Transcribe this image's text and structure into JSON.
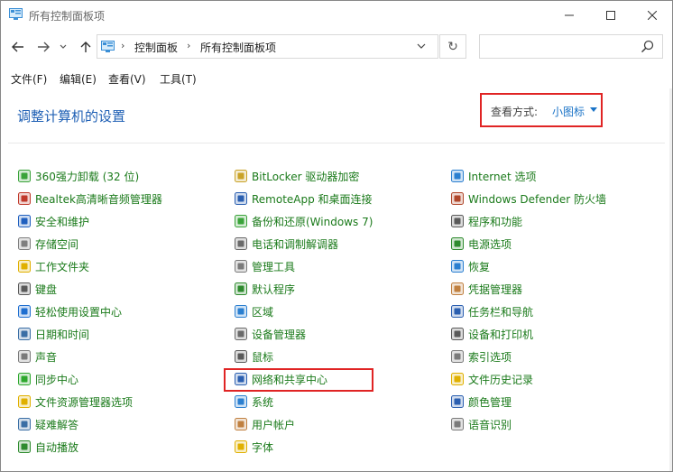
{
  "window": {
    "title": "所有控制面板项",
    "controls": {
      "minimize": "—",
      "maximize": "☐",
      "close": "✕"
    }
  },
  "nav": {
    "back": "←",
    "forward": "→",
    "history": "⌄",
    "up": "↑",
    "breadcrumb": [
      "控制面板",
      "所有控制面板项"
    ],
    "separator": "›",
    "dropdown": "⌄",
    "refresh": "↻",
    "search_placeholder": ""
  },
  "menu": [
    "文件(F)",
    "编辑(E)",
    "查看(V)",
    "工具(T)"
  ],
  "main": {
    "heading": "调整计算机的设置",
    "view_by_label": "查看方式:",
    "view_by_value": "小图标"
  },
  "items": [
    {
      "label": "360强力卸载 (32 位)",
      "icon": "uninstall-icon",
      "color": "#3aa33a"
    },
    {
      "label": "Realtek高清晰音频管理器",
      "icon": "audio-manager-icon",
      "color": "#c0392b"
    },
    {
      "label": "安全和维护",
      "icon": "flag-icon",
      "color": "#1f5fbf"
    },
    {
      "label": "存储空间",
      "icon": "storage-icon",
      "color": "#7f7f7f"
    },
    {
      "label": "工作文件夹",
      "icon": "folder-icon",
      "color": "#e0b000"
    },
    {
      "label": "键盘",
      "icon": "keyboard-icon",
      "color": "#5a5a5a"
    },
    {
      "label": "轻松使用设置中心",
      "icon": "ease-of-access-icon",
      "color": "#1f6fd0"
    },
    {
      "label": "日期和时间",
      "icon": "calendar-clock-icon",
      "color": "#3a6ea5"
    },
    {
      "label": "声音",
      "icon": "speaker-icon",
      "color": "#7a7a7a"
    },
    {
      "label": "同步中心",
      "icon": "sync-icon",
      "color": "#2ea82e"
    },
    {
      "label": "文件资源管理器选项",
      "icon": "folder-options-icon",
      "color": "#e0b000"
    },
    {
      "label": "疑难解答",
      "icon": "troubleshoot-icon",
      "color": "#3a6ea5"
    },
    {
      "label": "自动播放",
      "icon": "autoplay-icon",
      "color": "#2e8b2e"
    },
    {
      "label": "BitLocker 驱动器加密",
      "icon": "bitlocker-icon",
      "color": "#c9a227"
    },
    {
      "label": "RemoteApp 和桌面连接",
      "icon": "remoteapp-icon",
      "color": "#2b5fb0"
    },
    {
      "label": "备份和还原(Windows 7)",
      "icon": "backup-icon",
      "color": "#3aa33a"
    },
    {
      "label": "电话和调制解调器",
      "icon": "modem-icon",
      "color": "#6a6a6a"
    },
    {
      "label": "管理工具",
      "icon": "admin-tools-icon",
      "color": "#7a7a7a"
    },
    {
      "label": "默认程序",
      "icon": "default-programs-icon",
      "color": "#2e8b2e"
    },
    {
      "label": "区域",
      "icon": "region-icon",
      "color": "#2b7fd0"
    },
    {
      "label": "设备管理器",
      "icon": "device-manager-icon",
      "color": "#6a6a6a"
    },
    {
      "label": "鼠标",
      "icon": "mouse-icon",
      "color": "#5a5a5a"
    },
    {
      "label": "网络和共享中心",
      "icon": "network-sharing-icon",
      "color": "#2b5fb0"
    },
    {
      "label": "系统",
      "icon": "system-icon",
      "color": "#2b7fd0"
    },
    {
      "label": "用户帐户",
      "icon": "user-accounts-icon",
      "color": "#c08040"
    },
    {
      "label": "字体",
      "icon": "fonts-icon",
      "color": "#e0b000"
    },
    {
      "label": "Internet 选项",
      "icon": "internet-options-icon",
      "color": "#2b7fd0"
    },
    {
      "label": "Windows Defender 防火墙",
      "icon": "firewall-icon",
      "color": "#b0472b"
    },
    {
      "label": "程序和功能",
      "icon": "programs-features-icon",
      "color": "#5a5a5a"
    },
    {
      "label": "电源选项",
      "icon": "power-options-icon",
      "color": "#2e8b2e"
    },
    {
      "label": "恢复",
      "icon": "recovery-icon",
      "color": "#2b7fd0"
    },
    {
      "label": "凭据管理器",
      "icon": "credential-manager-icon",
      "color": "#c08040"
    },
    {
      "label": "任务栏和导航",
      "icon": "taskbar-icon",
      "color": "#2b5fb0"
    },
    {
      "label": "设备和打印机",
      "icon": "printer-icon",
      "color": "#5a5a5a"
    },
    {
      "label": "索引选项",
      "icon": "indexing-icon",
      "color": "#7a7a7a"
    },
    {
      "label": "文件历史记录",
      "icon": "file-history-icon",
      "color": "#e0b000"
    },
    {
      "label": "颜色管理",
      "icon": "color-management-icon",
      "color": "#2b5fb0"
    },
    {
      "label": "语音识别",
      "icon": "microphone-icon",
      "color": "#7a7a7a"
    }
  ]
}
